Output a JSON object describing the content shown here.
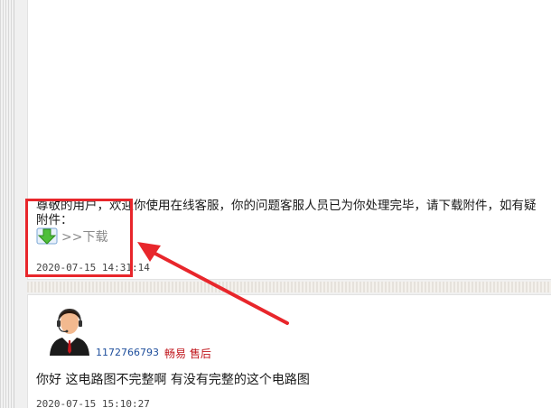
{
  "message_1": {
    "line_1": "尊敬的用户，欢迎你使用在线客服，你的问题客服人员已为你处理完毕，请下载附件，如有疑",
    "line_2": "附件：",
    "download_label": ">>下载",
    "timestamp": "2020-07-15 14:31:14",
    "download_icon": "download-arrow-icon"
  },
  "message_2": {
    "avatar_icon": "customer-service-agent-avatar",
    "user_id": "1172766793",
    "role": "畅易  售后",
    "text": "你好  这电路图不完整啊  有没有完整的这个电路图",
    "timestamp": "2020-07-15 15:10:27"
  },
  "annotation": {
    "color": "#e8262b"
  }
}
